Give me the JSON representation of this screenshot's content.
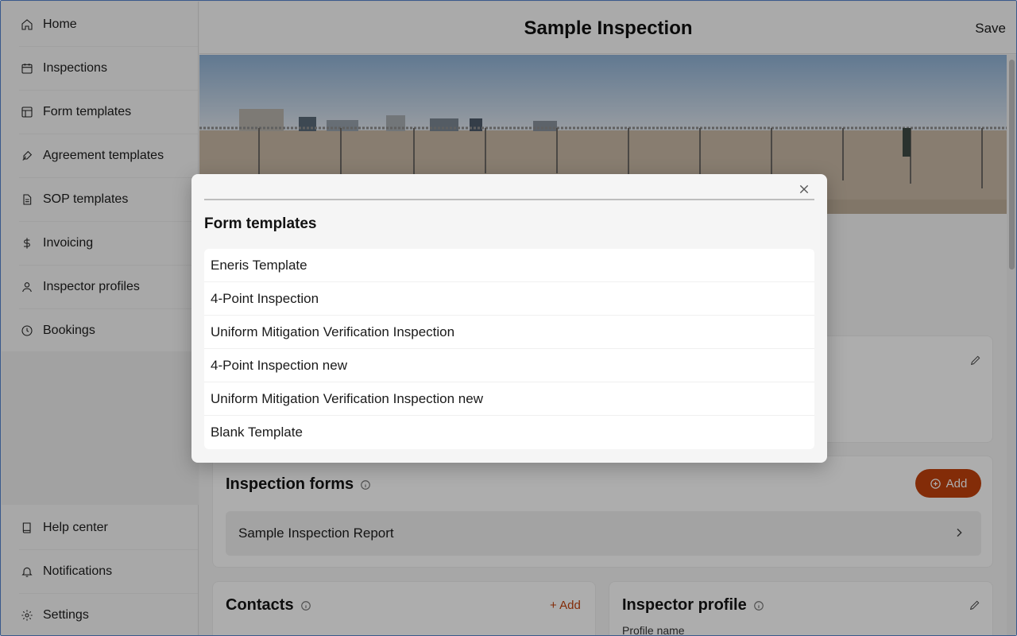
{
  "sidebar": {
    "items": [
      {
        "label": "Home",
        "icon": "home-icon"
      },
      {
        "label": "Inspections",
        "icon": "calendar-icon"
      },
      {
        "label": "Form templates",
        "icon": "layout-icon"
      },
      {
        "label": "Agreement templates",
        "icon": "signature-icon"
      },
      {
        "label": "SOP templates",
        "icon": "document-icon"
      },
      {
        "label": "Invoicing",
        "icon": "dollar-icon"
      },
      {
        "label": "Inspector profiles",
        "icon": "user-icon"
      },
      {
        "label": "Bookings",
        "icon": "clock-icon"
      }
    ],
    "bottom_items": [
      {
        "label": "Help center",
        "icon": "book-icon"
      },
      {
        "label": "Notifications",
        "icon": "bell-icon"
      },
      {
        "label": "Settings",
        "icon": "gear-icon"
      }
    ]
  },
  "header": {
    "title": "Sample Inspection",
    "save_label": "Save"
  },
  "inspection_forms": {
    "title": "Inspection forms",
    "add_label": "Add",
    "rows": [
      "Sample Inspection Report"
    ]
  },
  "contacts": {
    "title": "Contacts",
    "add_label": "+ Add"
  },
  "inspector_profile": {
    "title": "Inspector profile",
    "field_label": "Profile name"
  },
  "modal": {
    "title": "Form templates",
    "templates": [
      "Eneris Template",
      "4-Point Inspection",
      "Uniform Mitigation Verification Inspection",
      "4-Point Inspection new",
      "Uniform Mitigation Verification Inspection new",
      "Blank Template"
    ]
  },
  "colors": {
    "accent": "#c2410c",
    "overlay": "rgba(0,0,0,0.32)"
  }
}
